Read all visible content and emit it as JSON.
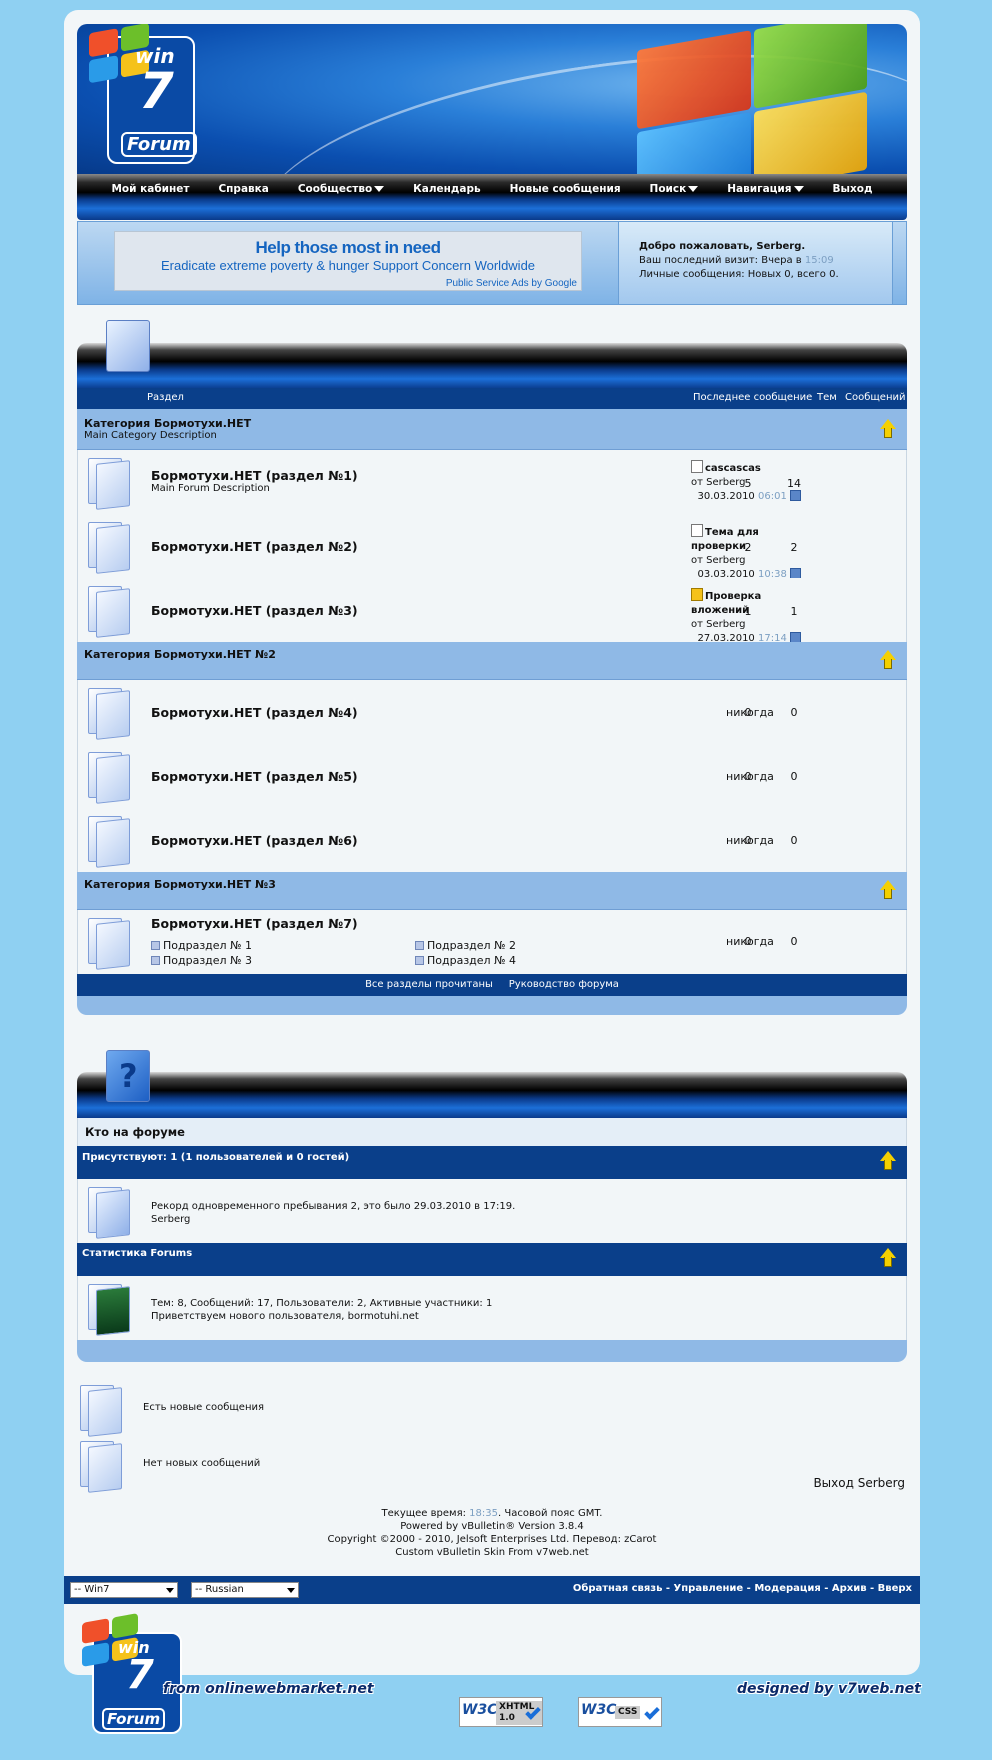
{
  "nav": {
    "items": [
      "Мой кабинет",
      "Справка",
      "Сообщество",
      "Календарь",
      "Новые сообщения",
      "Поиск",
      "Навигация",
      "Выход"
    ]
  },
  "logo": {
    "win": "win",
    "seven": "7",
    "forum": "Forum"
  },
  "ad": {
    "headline": "Help those most in need",
    "subline": "Eradicate extreme poverty & hunger Support Concern Worldwide",
    "attribution": "Public Service Ads by Google"
  },
  "welcome": {
    "greeting": "Добро пожаловать, Serberg.",
    "last_visit_label": "Ваш последний визит: Вчера в",
    "last_visit_time": "15:09",
    "pm": "Личные сообщения: Новых 0, всего 0."
  },
  "forum_table": {
    "headers": {
      "section": "Раздел",
      "last_post": "Последнее сообщение",
      "threads": "Тем",
      "posts": "Сообщений"
    }
  },
  "categories": [
    {
      "title": "Категория Бормотухи.НЕТ",
      "description": "Main Category Description",
      "forums": [
        {
          "title": "Бормотухи.НЕТ (раздел №1)",
          "description": "Main Forum Description",
          "lp_title": "cascascas",
          "lp_by": "от Serberg",
          "lp_date": "30.03.2010",
          "lp_time": "06:01",
          "threads": "5",
          "posts": "14"
        },
        {
          "title": "Бормотухи.НЕТ (раздел №2)",
          "lp_title": "Тема для проверки",
          "lp_by": "от Serberg",
          "lp_date": "03.03.2010",
          "lp_time": "10:38",
          "threads": "2",
          "posts": "2"
        },
        {
          "title": "Бормотухи.НЕТ (раздел №3)",
          "lp_title": "Проверка вложений",
          "lp_by": "от Serberg",
          "lp_date": "27.03.2010",
          "lp_time": "17:14",
          "threads": "1",
          "posts": "1"
        }
      ]
    },
    {
      "title": "Категория Бормотухи.НЕТ №2",
      "forums": [
        {
          "title": "Бормотухи.НЕТ (раздел №4)",
          "last": "никогда",
          "threads": "0",
          "posts": "0"
        },
        {
          "title": "Бормотухи.НЕТ (раздел №5)",
          "last": "никогда",
          "threads": "0",
          "posts": "0"
        },
        {
          "title": "Бормотухи.НЕТ (раздел №6)",
          "last": "никогда",
          "threads": "0",
          "posts": "0"
        }
      ]
    },
    {
      "title": "Категория Бормотухи.НЕТ №3",
      "forums": [
        {
          "title": "Бормотухи.НЕТ (раздел №7)",
          "last": "никогда",
          "threads": "0",
          "posts": "0",
          "subforums": [
            "Подраздел № 1",
            "Подраздел № 2",
            "Подраздел № 3",
            "Подраздел № 4"
          ]
        }
      ]
    }
  ],
  "forum_footer": {
    "mark_read": "Все разделы прочитаны",
    "guide": "Руководство форума"
  },
  "whos_online": {
    "title": "Кто на форуме",
    "present": "Присутствуют: 1 (1 пользователей и 0 гостей)",
    "record": "Рекорд одновременного пребывания 2, это было 29.03.2010 в 17:19.",
    "users": "Serberg",
    "stats_title": "Статистика Forums",
    "stats": "Тем: 8, Сообщений: 17, Пользователи: 2, Активные участники: 1",
    "newest": "Приветствуем нового пользователя, bormotuhi.net"
  },
  "legend": {
    "new": "Есть новые сообщения",
    "no_new": "Нет новых сообщений"
  },
  "logout": "Выход Serberg",
  "copyright": {
    "time_label": "Текущее время:",
    "time": "18:35",
    "tz": ". Часовой пояс GMT.",
    "powered": "Powered by vBulletin® Version 3.8.4",
    "copy": "Copyright ©2000 - 2010, Jelsoft Enterprises Ltd. Перевод: zCarot",
    "skin": "Custom vBulletin Skin From v7web.net"
  },
  "bottom": {
    "style_select": "-- Win7",
    "lang_select": "-- Russian",
    "links": "Обратная связь - Управление - Модерация - Архив - Вверх"
  },
  "credits": {
    "left": "from onlinewebmarket.net",
    "right": "designed by v7web.net",
    "xhtml": "XHTML 1.0",
    "css": "CSS",
    "w3c": "W3C"
  },
  "colors": {
    "flag_red": "#f0502a",
    "flag_green": "#6cbf2a",
    "flag_blue": "#2a9be8",
    "flag_yellow": "#f5c21a",
    "dark_blue": "#0a3f8a",
    "light_blue": "#8fb9e6"
  }
}
